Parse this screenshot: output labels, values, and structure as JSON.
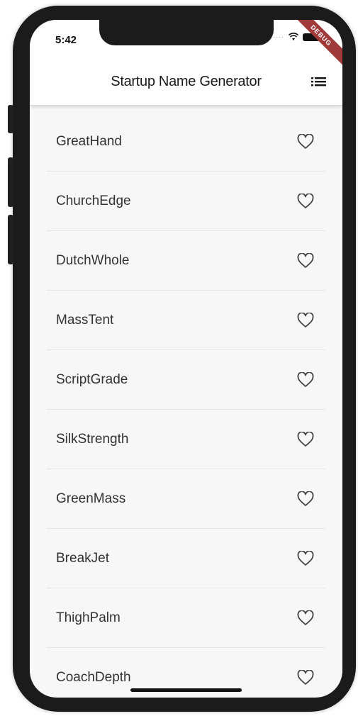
{
  "status": {
    "time": "5:42",
    "debug_label": "DEBUG"
  },
  "appbar": {
    "title": "Startup Name Generator",
    "menu_icon": "list-icon"
  },
  "names": [
    "GreatHand",
    "ChurchEdge",
    "DutchWhole",
    "MassTent",
    "ScriptGrade",
    "SilkStrength",
    "GreenMass",
    "BreakJet",
    "ThighPalm",
    "CoachDepth"
  ],
  "row_icon": "heart-outline-icon",
  "colors": {
    "banner": "#a03a3a",
    "appbar": "#ffffff",
    "background": "#f7f7f7"
  }
}
